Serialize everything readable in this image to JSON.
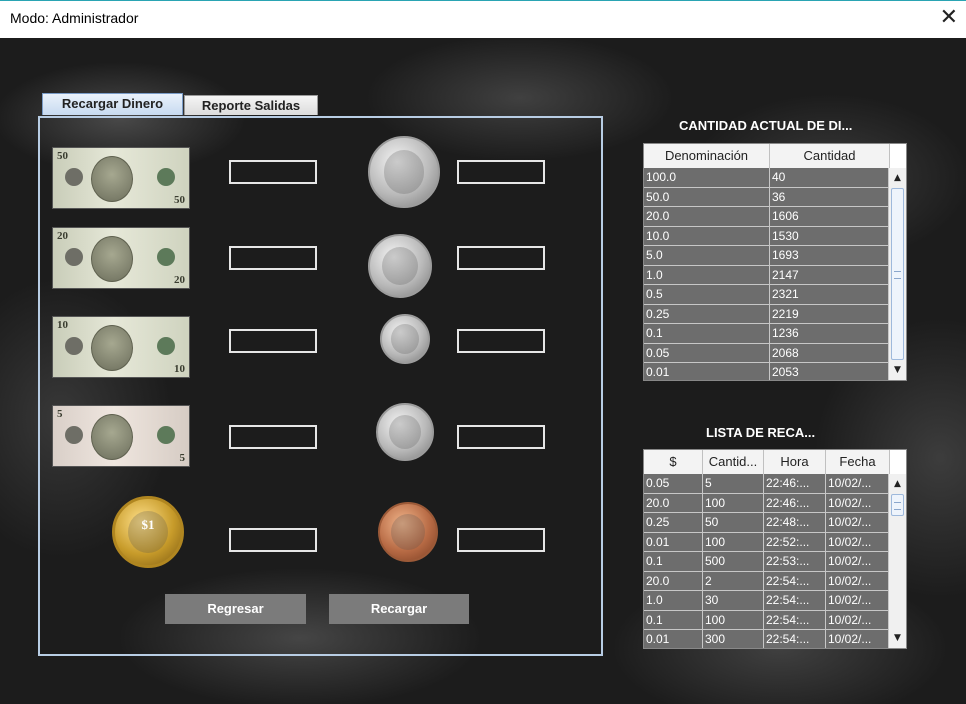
{
  "window": {
    "title": "Modo: Administrador",
    "close_glyph": "✕"
  },
  "tabs": [
    {
      "label": "Recargar Dinero",
      "active": true
    },
    {
      "label": "Reporte Salidas",
      "active": false
    }
  ],
  "bills": [
    {
      "value": "50",
      "icon": "fifty-dollar-bill-icon"
    },
    {
      "value": "20",
      "icon": "twenty-dollar-bill-icon"
    },
    {
      "value": "10",
      "icon": "ten-dollar-bill-icon"
    },
    {
      "value": "5",
      "icon": "five-dollar-bill-icon"
    },
    {
      "value": "$1",
      "icon": "one-dollar-coin-icon"
    }
  ],
  "coins": [
    {
      "icon": "half-dollar-coin-icon"
    },
    {
      "icon": "quarter-coin-icon"
    },
    {
      "icon": "dime-coin-icon"
    },
    {
      "icon": "nickel-coin-icon"
    },
    {
      "icon": "penny-coin-icon"
    }
  ],
  "buttons": {
    "back": "Regresar",
    "reload": "Recargar"
  },
  "inventory": {
    "title": "CANTIDAD ACTUAL DE DI...",
    "columns": [
      "Denominación",
      "Cantidad"
    ],
    "rows": [
      [
        "100.0",
        "40"
      ],
      [
        "50.0",
        "36"
      ],
      [
        "20.0",
        "1606"
      ],
      [
        "10.0",
        "1530"
      ],
      [
        "5.0",
        "1693"
      ],
      [
        "1.0",
        "2147"
      ],
      [
        "0.5",
        "2321"
      ],
      [
        "0.25",
        "2219"
      ],
      [
        "0.1",
        "1236"
      ],
      [
        "0.05",
        "2068"
      ],
      [
        "0.01",
        "2053"
      ]
    ]
  },
  "reloads": {
    "title": "LISTA DE RECA...",
    "columns": [
      "$",
      "Cantid...",
      "Hora",
      "Fecha"
    ],
    "rows": [
      [
        "0.05",
        "5",
        "22:46:...",
        "10/02/..."
      ],
      [
        "20.0",
        "100",
        "22:46:...",
        "10/02/..."
      ],
      [
        "0.25",
        "50",
        "22:48:...",
        "10/02/..."
      ],
      [
        "0.01",
        "100",
        "22:52:...",
        "10/02/..."
      ],
      [
        "0.1",
        "500",
        "22:53:...",
        "10/02/..."
      ],
      [
        "20.0",
        "2",
        "22:54:...",
        "10/02/..."
      ],
      [
        "1.0",
        "30",
        "22:54:...",
        "10/02/..."
      ],
      [
        "0.1",
        "100",
        "22:54:...",
        "10/02/..."
      ],
      [
        "0.01",
        "300",
        "22:54:...",
        "10/02/..."
      ]
    ]
  },
  "colors": {
    "accent": "#2aa4b3",
    "button_bg": "#7b7b7b",
    "cell_bg": "#6d6d6d",
    "panel_border": "#b8cde4"
  }
}
